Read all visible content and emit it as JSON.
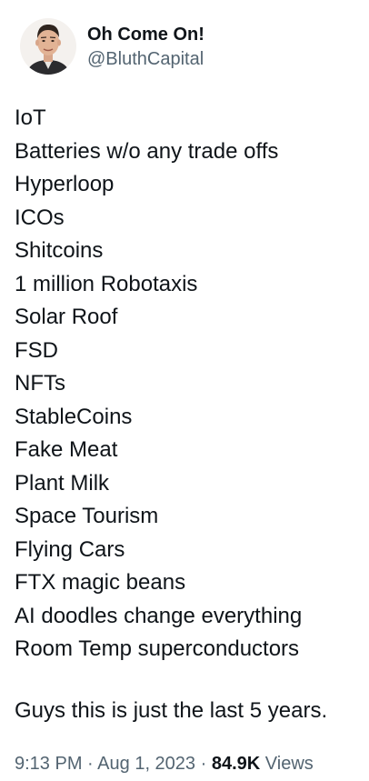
{
  "author": {
    "display_name": "Oh Come On!",
    "handle": "@BluthCapital",
    "avatar_icon": "man-portrait-avatar"
  },
  "tweet": {
    "lines": [
      "IoT",
      "Batteries w/o any trade offs",
      "Hyperloop",
      "ICOs",
      "Shitcoins",
      "1 million Robotaxis",
      "Solar Roof",
      "FSD",
      "NFTs",
      "StableCoins",
      "Fake Meat",
      "Plant Milk",
      "Space Tourism",
      "Flying Cars",
      "FTX magic beans",
      "AI doodles change everything",
      "Room Temp superconductors"
    ],
    "closing": "Guys this is just the last 5 years."
  },
  "meta": {
    "time": "9:13 PM",
    "separator": "·",
    "date": "Aug 1, 2023",
    "views_count": "84.9K",
    "views_label": "Views"
  },
  "colors": {
    "text": "#0f1419",
    "secondary": "#536471"
  }
}
